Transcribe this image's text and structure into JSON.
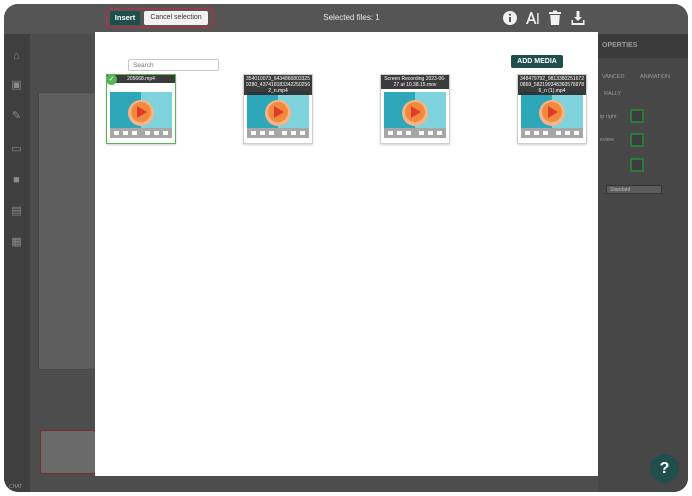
{
  "topbar": {
    "insert_label": "Insert",
    "cancel_label": "Cancel selection",
    "selected_files": "Selected files: 1"
  },
  "modal": {
    "search_placeholder": "Search",
    "add_media_label": "ADD MEDIA",
    "media": [
      {
        "caption": "205668.mp4",
        "selected": true
      },
      {
        "caption": "354010073_643486680332​59280_4374181833422502562_n.mp4",
        "selected": false
      },
      {
        "caption": "Screen Recording 2023-06-27 at 10.38.15.mov",
        "selected": false
      },
      {
        "caption": "348479792_981338025167​20869_5821993483605769786_n (1).mp4",
        "selected": false
      }
    ]
  },
  "background": {
    "right_panel_title": "OPERTIES",
    "tabs": [
      "VANCED",
      "ANIMATION"
    ],
    "section_label": "RALLY",
    "label_right": "ip right",
    "label_preview": "eview",
    "select_value": "Standard",
    "chat_label": "CHAT"
  },
  "help_label": "?",
  "colors": {
    "accent": "#1f4e4c",
    "selected_border": "#5ab55a",
    "highlight_outline": "#c8283c"
  }
}
